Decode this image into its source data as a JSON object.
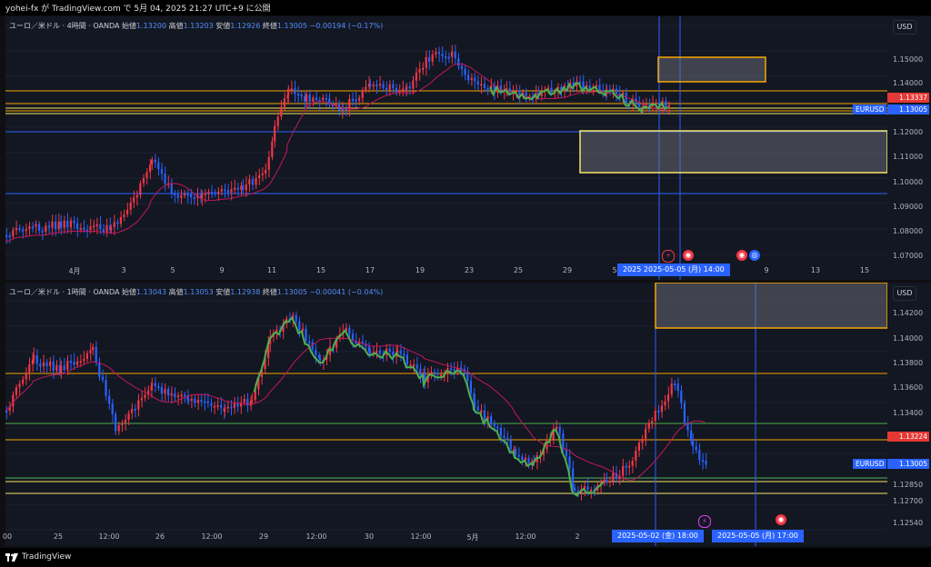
{
  "header": {
    "published": "yohei-fx が TradingView.com で 5月 04, 2025 21:27 UTC+9 に公開"
  },
  "footer": {
    "brand": "TradingView"
  },
  "colors": {
    "bg": "#131722",
    "up": "#f23645",
    "down": "#2962ff",
    "ma": "#c2185b",
    "green": "#4caf50",
    "orange": "#f7a600",
    "yellow": "#f5e663"
  },
  "charts": [
    {
      "legend": {
        "title": "ユーロ／米ドル · 4時間 · OANDA",
        "o_label": "始値",
        "o": "1.13200",
        "h_label": "高値",
        "h": "1.13203",
        "l_label": "安値",
        "l": "1.12926",
        "c_label": "終値",
        "c": "1.13005",
        "chg": "−0.00194 (−0.17%)"
      },
      "currency": "USD",
      "price_labels": [
        "1.15000",
        "1.14000",
        "1.12000",
        "1.11000",
        "1.10000",
        "1.09000",
        "1.08000",
        "1.07000"
      ],
      "tags": {
        "red": "1.13337",
        "symbol": "EURUSD",
        "blue": "1.13005"
      },
      "time_labels": [
        "4月",
        "3",
        "5",
        "9",
        "11",
        "15",
        "17",
        "19",
        "23",
        "25",
        "29",
        "5",
        "9",
        "13",
        "15"
      ],
      "time_box": {
        "year": "2025",
        "date": "2025-05-05 (月)",
        "time": "14:00"
      }
    },
    {
      "legend": {
        "title": "ユーロ／米ドル · 1時間 · OANDA",
        "o_label": "始値",
        "o": "1.13043",
        "h_label": "高値",
        "h": "1.13053",
        "l_label": "安値",
        "l": "1.12938",
        "c_label": "終値",
        "c": "1.13005",
        "chg": "−0.00041 (−0.04%)"
      },
      "currency": "USD",
      "price_labels": [
        "1.14200",
        "1.14000",
        "1.13800",
        "1.13600",
        "1.13400",
        "1.12850",
        "1.12700",
        "1.12540"
      ],
      "tags": {
        "red": "1.13224",
        "symbol": "EURUSD",
        "blue": "1.13005"
      },
      "time_labels": [
        "00",
        "25",
        "12:00",
        "26",
        "12:00",
        "29",
        "12:00",
        "30",
        "12:00",
        "5月",
        "12:00",
        "2",
        "12:00"
      ],
      "time_box_a": {
        "date": "2025-05-02 (金)",
        "time": "18:00"
      },
      "time_box_b": {
        "date": "2025-05-05 (月)",
        "time": "17:00"
      }
    }
  ]
}
